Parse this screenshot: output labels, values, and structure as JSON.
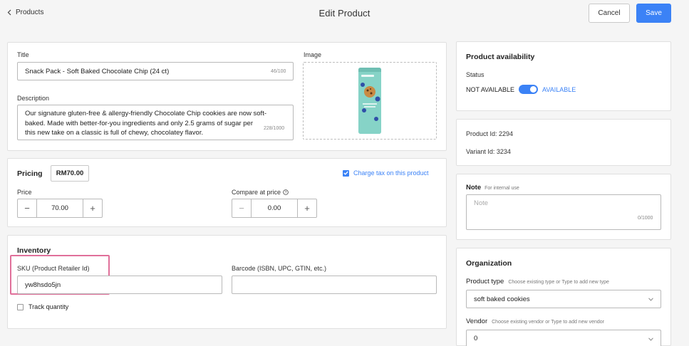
{
  "header": {
    "back_label": "Products",
    "title": "Edit Product",
    "cancel_label": "Cancel",
    "save_label": "Save"
  },
  "details": {
    "title_label": "Title",
    "title_value": "Snack Pack - Soft Baked Chocolate Chip (24 ct)",
    "title_counter": "46/100",
    "image_label": "Image",
    "description_label": "Description",
    "description_lines": [
      "Our signature gluten-free & allergy-friendly Chocolate Chip cookies are now soft-",
      "baked. Made with better-for-you ingredients and only 2.5 grams of sugar per",
      "this new take on a classic is full of chewy, chocolatey flavor."
    ],
    "description_counter": "228/1000"
  },
  "pricing": {
    "heading": "Pricing",
    "total_badge": "RM70.00",
    "charge_tax_label": "Charge tax on this product",
    "charge_tax_checked": true,
    "price_label": "Price",
    "price_value": "70.00",
    "compare_label": "Compare at price",
    "compare_value": "0.00"
  },
  "inventory": {
    "heading": "Inventory",
    "sku_label": "SKU (Product Retailer Id)",
    "sku_value": "yw8hsdo5jn",
    "barcode_label": "Barcode (ISBN, UPC, GTIN, etc.)",
    "barcode_value": "",
    "track_quantity_label": "Track quantity",
    "track_quantity_checked": false
  },
  "availability": {
    "heading": "Product availability",
    "status_label": "Status",
    "off_label": "NOT AVAILABLE",
    "on_label": "AVAILABLE",
    "available": true
  },
  "ids": {
    "product_id": "Product Id: 2294",
    "variant_id": "Variant Id: 3234"
  },
  "note": {
    "label": "Note",
    "hint": "For internal use",
    "placeholder": "Note",
    "counter": "0/1000"
  },
  "organization": {
    "heading": "Organization",
    "product_type_label": "Product type",
    "product_type_hint": "Choose existing type or Type to add new type",
    "product_type_value": "soft baked cookies",
    "vendor_label": "Vendor",
    "vendor_hint": "Choose existing vendor or Type to add new vendor",
    "vendor_value": "0"
  },
  "colors": {
    "accent": "#3b82f6",
    "highlight": "#e0709a",
    "background": "#f5f5f5"
  },
  "icons": {
    "back": "chevron-left-icon",
    "help": "question-circle-icon",
    "dropdown": "chevron-down-icon",
    "check": "check-icon"
  }
}
